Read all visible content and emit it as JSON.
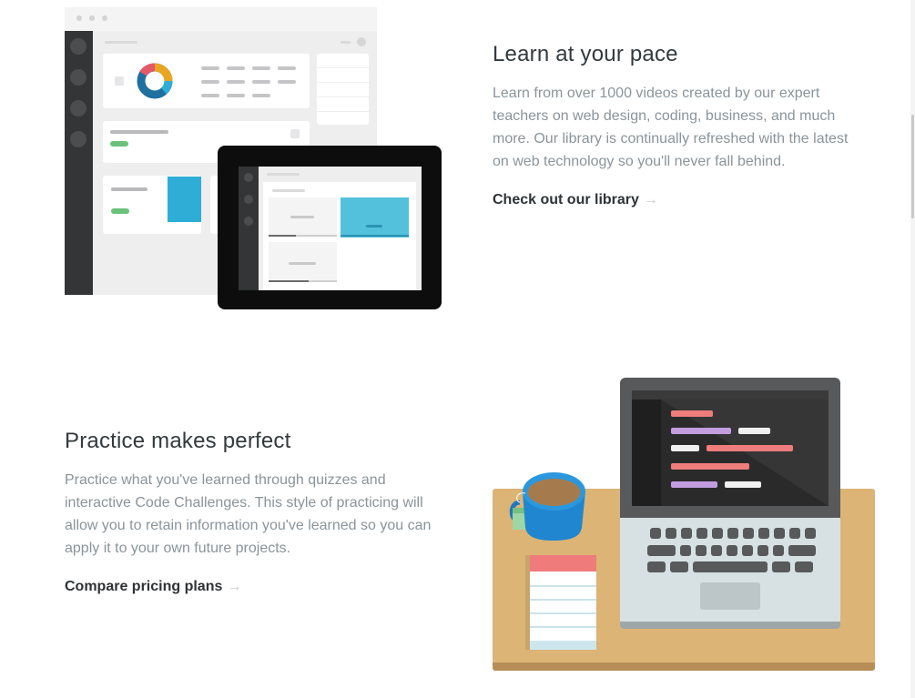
{
  "features": [
    {
      "title": "Learn at your pace",
      "description": "Learn from over 1000 videos created by our expert teachers on web design, coding, business, and much more. Our library is continually refreshed with the latest on web technology so you'll never fall behind.",
      "link_label": "Check out our library",
      "arrow_icon": "arrow-right-icon"
    },
    {
      "title": "Practice makes perfect",
      "description": "Practice what you've learned through quizzes and interactive Code Challenges. This style of practicing will allow you to retain information you've learned so you can apply it to your own future projects.",
      "link_label": "Compare pricing plans",
      "arrow_icon": "arrow-right-icon"
    }
  ],
  "colors": {
    "title": "#333a3d",
    "body": "#8a949a",
    "link": "#2f3336",
    "arrow": "#c5c9cb",
    "accent_blue": "#2eaed6",
    "accent_green": "#6cc17a",
    "desk": "#dcb475"
  },
  "icons": {
    "arrow": "→"
  }
}
